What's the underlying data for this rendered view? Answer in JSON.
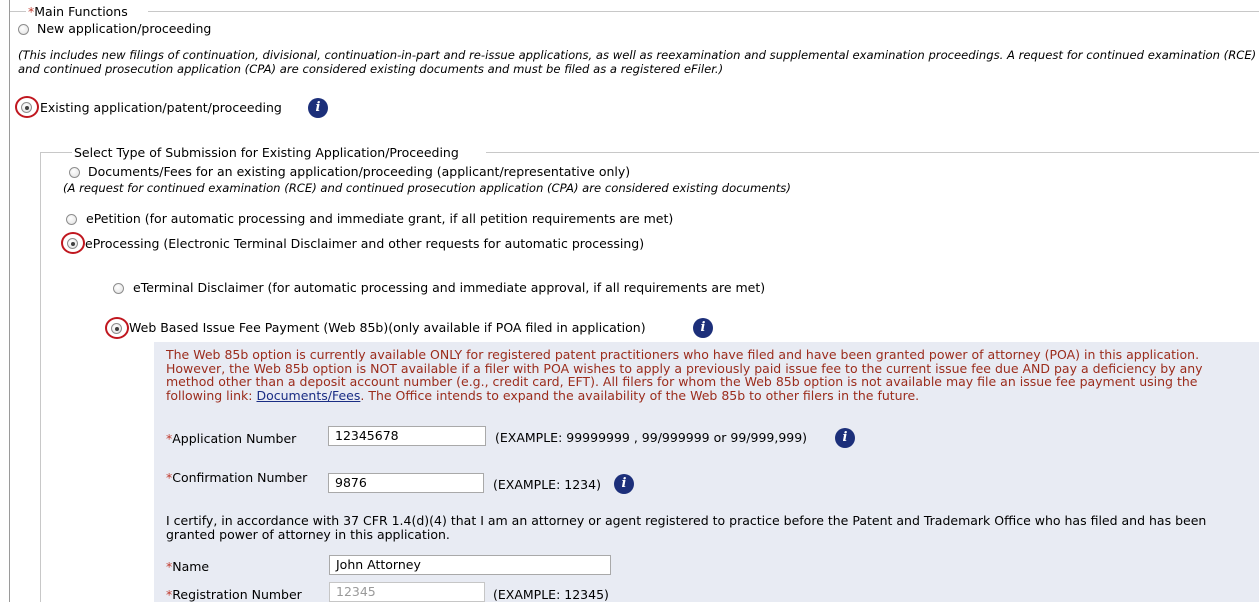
{
  "main_functions": {
    "legend": "Main Functions",
    "new_application_label": "New application/proceeding",
    "new_application_note": "(This includes new filings of continuation, divisional, continuation-in-part and re-issue applications, as well as reexamination and supplemental examination proceedings. A request for continued examination (RCE) and continued prosecution application (CPA) are considered existing documents and must be filed as a registered eFiler.)",
    "existing_label": "Existing application/patent/proceeding"
  },
  "submission_type": {
    "legend": "Select Type of Submission for Existing Application/Proceeding",
    "documents_fees_label": "Documents/Fees for an existing application/proceeding (applicant/representative only)",
    "documents_fees_note": "(A request for continued examination (RCE) and continued prosecution application (CPA) are considered existing documents)",
    "epetition_label": "ePetition (for automatic processing and immediate grant, if all petition requirements are met)",
    "eprocessing_label": "eProcessing (Electronic Terminal Disclaimer and other requests for automatic processing)"
  },
  "eprocessing_options": {
    "eterminal_label": "eTerminal Disclaimer (for automatic processing and immediate approval, if all requirements are met)",
    "web85b_label": "Web Based Issue Fee Payment (Web 85b)(only available if POA filed in application)"
  },
  "web85b_panel": {
    "notice_text": "The Web 85b option is currently available ONLY for registered patent practitioners who have filed and have been granted power of attorney (POA) in this application. However, the Web 85b option is NOT available if a filer with POA wishes to apply a previously paid issue fee to the current issue fee due AND pay a deficiency by any method other than a deposit account number (e.g., credit card, EFT). All filers for whom the Web 85b option is not available may file an issue fee payment using the following link:",
    "notice_link": "Documents/Fees",
    "notice_tail": ". The Office intends to expand the availability of the Web 85b to other filers in the future.",
    "application_number_label": "Application Number",
    "application_number_value": "12345678",
    "application_number_example": "(EXAMPLE: 99999999 , 99/999999 or 99/999,999)",
    "confirmation_number_label": "Confirmation Number",
    "confirmation_number_value": "9876",
    "confirmation_number_example": "(EXAMPLE: 1234)",
    "certify_text": "I certify, in accordance with 37 CFR 1.4(d)(4) that I am an attorney or agent registered to practice before the Patent and Trademark Office who has filed and has been granted power of attorney in this application.",
    "name_label": "Name",
    "name_value": "John Attorney",
    "registration_number_label": "Registration Number",
    "registration_number_value": "12345",
    "registration_number_example": "(EXAMPLE: 12345)"
  },
  "required_marker": "*",
  "colors": {
    "required": "#c0392b",
    "notice_text": "#9b2c1c",
    "panel_background": "#e8ebf3",
    "highlight_ring": "#c0171f",
    "info_icon": "#1c2f7a"
  }
}
